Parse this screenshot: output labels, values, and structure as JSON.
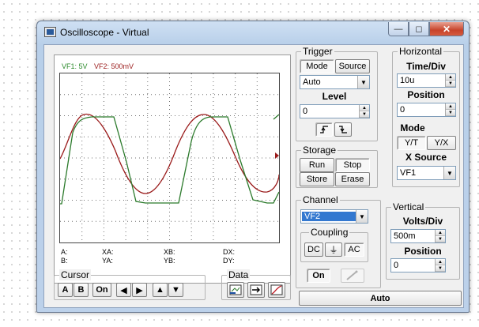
{
  "window": {
    "title": "Oscilloscope - Virtual",
    "controls": {
      "minimize": "—",
      "maximize": "◻",
      "close": "✕"
    }
  },
  "scope": {
    "channel_labels": {
      "vf1": "VF1: 5V",
      "vf2": "VF2: 500mV"
    },
    "colors": {
      "vf1": "#2b8a2b",
      "vf2": "#9a1a1a",
      "grid": "#6f6f6f"
    },
    "cursor_readout": {
      "row1": [
        "A:",
        "XA:",
        "XB:",
        "DX:"
      ],
      "row2": [
        "B:",
        "YA:",
        "YB:",
        "DY:"
      ]
    }
  },
  "trigger": {
    "legend": "Trigger",
    "mode_button": "Mode",
    "source_button": "Source",
    "mode_value": "Auto",
    "level_label": "Level",
    "level_value": "0",
    "edge_rising": "⨍",
    "edge_falling": "⨍"
  },
  "storage": {
    "legend": "Storage",
    "run": "Run",
    "stop": "Stop",
    "store": "Store",
    "erase": "Erase"
  },
  "horizontal": {
    "legend": "Horizontal",
    "time_div_label": "Time/Div",
    "time_div_value": "10u",
    "position_label": "Position",
    "position_value": "0",
    "mode_label": "Mode",
    "mode_yt": "Y/T",
    "mode_yx": "Y/X",
    "xsource_label": "X Source",
    "xsource_value": "VF1"
  },
  "channel": {
    "legend": "Channel",
    "selected": "VF2",
    "coupling_legend": "Coupling",
    "dc": "DC",
    "ground": "⏚",
    "ac": "AC",
    "on": "On"
  },
  "vertical": {
    "legend": "Vertical",
    "volts_div_label": "Volts/Div",
    "volts_div_value": "500m",
    "position_label": "Position",
    "position_value": "0"
  },
  "cursor": {
    "legend": "Cursor",
    "a": "A",
    "b": "B",
    "on": "On"
  },
  "data": {
    "legend": "Data"
  },
  "auto_button": "Auto"
}
